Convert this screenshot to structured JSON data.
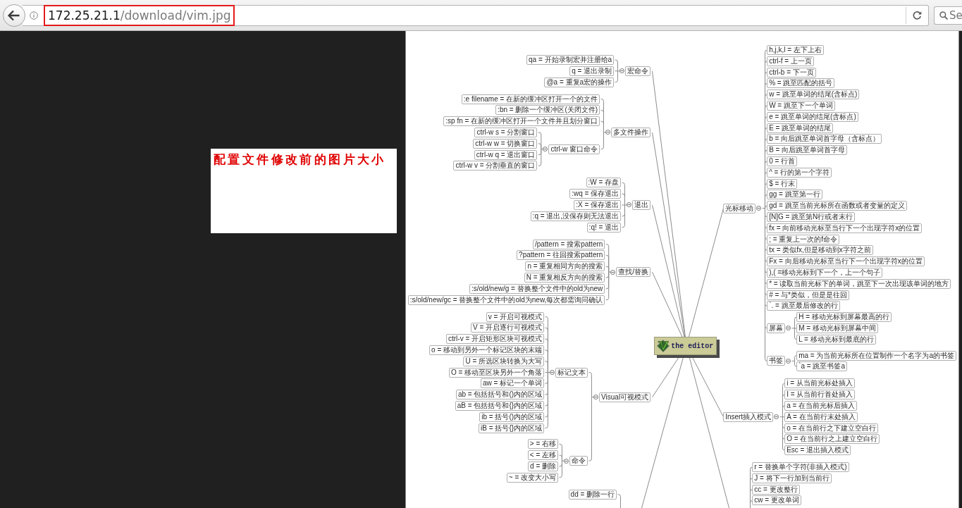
{
  "browser": {
    "url": {
      "host": "172.25.21.1",
      "path": "/download/vim.jpg"
    },
    "search": {
      "placeholder": "Se"
    }
  },
  "note": {
    "text": "配置文件修改前的图片大小"
  },
  "mindmap": {
    "center": "the editor",
    "left": [
      {
        "text": "宏命令",
        "children": [
          {
            "text": "qa = 开始录制宏并注册给a"
          },
          {
            "text": "q = 退出录制"
          },
          {
            "text": "@a = 重复a宏的操作"
          }
        ]
      },
      {
        "text": "多文件操作",
        "children": [
          {
            "text": ":e filename = 在新的缓冲区打开一个的文件"
          },
          {
            "text": ":bn = 删除一个缓冲区(关闭文件)"
          },
          {
            "text": ":sp fn = 在新的缓冲区打开一个文件并且划分窗口"
          },
          {
            "text": "ctrl-w 窗口命令",
            "children": [
              {
                "text": "ctrl-w s = 分割窗口"
              },
              {
                "text": "ctrl-w w = 切换窗口"
              },
              {
                "text": "ctrl-w q = 退出窗口"
              },
              {
                "text": "ctrl-w v = 分割垂直的窗口"
              }
            ]
          }
        ]
      },
      {
        "text": "退出",
        "children": [
          {
            "text": ":W = 存盘"
          },
          {
            "text": ":wq = 保存退出"
          },
          {
            "text": ":X = 保存退出"
          },
          {
            "text": ":q = 退出,没保存则无法退出"
          },
          {
            "text": ":q! = 退出"
          }
        ]
      },
      {
        "text": "查找/替换",
        "children": [
          {
            "text": "/pattern = 搜索pattern"
          },
          {
            "text": "?pattern = 往回搜索pattern"
          },
          {
            "text": "n = 重复相同方向的搜索"
          },
          {
            "text": "N = 重复相反方向的搜索"
          },
          {
            "text": ":s/old/new/g = 替换整个文件中的old为new"
          },
          {
            "text": ":s/old/new/gc = 替换整个文件中的old为new,每次都需询问确认"
          }
        ]
      },
      {
        "text": "Visual可视模式",
        "children": [
          {
            "text": "标记文本",
            "children": [
              {
                "text": "v = 开启可视模式"
              },
              {
                "text": "V = 开启逐行可视模式"
              },
              {
                "text": "ctrl-v = 开启矩形区块可视模式"
              },
              {
                "text": "o = 移动到另外一个标记区块的末端"
              },
              {
                "text": "U = 所选区块转换为大写"
              },
              {
                "text": "O = 移动至区块另外一个角落"
              },
              {
                "text": "aw = 标记一个单词"
              },
              {
                "text": "ab = 包括括号和()内的区域"
              },
              {
                "text": "aB = 包括括号和{}内的区域"
              },
              {
                "text": "ib = 括号()内的区域"
              },
              {
                "text": "iB = 括号{}内的区域"
              }
            ]
          },
          {
            "text": "命令",
            "children": [
              {
                "text": "> = 右移"
              },
              {
                "text": "< = 左移"
              },
              {
                "text": "d = 删除"
              },
              {
                "text": "~ = 改变大小写"
              }
            ]
          }
        ]
      },
      {
        "children": [
          {
            "text": "dd = 删除一行"
          }
        ]
      }
    ],
    "right": [
      {
        "text": "光标移动",
        "children": [
          {
            "text": "h,j,k,l = 左下上右"
          },
          {
            "text": "ctrl-f = 上一页"
          },
          {
            "text": "ctrl-b = 下一页"
          },
          {
            "text": "% = 跳至匹配的括号"
          },
          {
            "text": "w = 跳至单词的结尾(含标点)"
          },
          {
            "text": "W = 跳至下一个单词"
          },
          {
            "text": "e = 跳至单词的结尾(含标点)"
          },
          {
            "text": "E = 跳至单词的结尾"
          },
          {
            "text": "b = 向后跳至单词首字母（含标点）"
          },
          {
            "text": "B = 向后跳至单词首字母"
          },
          {
            "text": "0 = 行首"
          },
          {
            "text": "^ = 行的第一个字符"
          },
          {
            "text": "$ = 行末"
          },
          {
            "text": "gg = 跳至第一行"
          },
          {
            "text": "gd = 跳至当前光标所在函数或者变量的定义"
          },
          {
            "text": "[N]G = 跳至第N行或者末行"
          },
          {
            "text": "fx = 向前移动光标至当行下一个出现字符x的位置"
          },
          {
            "text": "; = 重复上一次的f命令"
          },
          {
            "text": "tx = 类似fx,但是移动到x字符之前"
          },
          {
            "text": "Fx = 向后移动光标至当行下一个出现字符x的位置"
          },
          {
            "text": "),( =移动光标到下一个，上一个句子"
          },
          {
            "text": "* = 读取当前光标下的单词，跳至下一次出现该单词的地方"
          },
          {
            "text": "# = 与*类似，但是是往回"
          },
          {
            "text": "`. = 跳至最后修改的行"
          },
          {
            "text": "屏幕",
            "children": [
              {
                "text": "H = 移动光标到屏幕最高的行"
              },
              {
                "text": "M = 移动光标到屏幕中间"
              },
              {
                "text": "L = 移动光标到最底的行"
              }
            ]
          },
          {
            "text": "书签",
            "children": [
              {
                "text": "ma = 为当前光标所在位置制作一个名字为a的书签"
              },
              {
                "text": "`a = 跳至书签a"
              }
            ]
          }
        ]
      },
      {
        "text": "Insert插入模式",
        "children": [
          {
            "text": "i = 从当前光标处插入"
          },
          {
            "text": "I = 从当前行首处插入"
          },
          {
            "text": "a = 在当前光标后插入"
          },
          {
            "text": "A = 在当前行末处插入"
          },
          {
            "text": "o = 在当前行之下建立空白行"
          },
          {
            "text": "O = 在当前行之上建立空白行"
          },
          {
            "text": "Esc = 退出插入模式"
          }
        ]
      },
      {
        "children": [
          {
            "text": "r = 替换单个字符(非插入模式)"
          },
          {
            "text": "J = 将下一行加到当前行"
          },
          {
            "text": "cc = 更改整行"
          },
          {
            "text": "cw = 更改单词"
          }
        ]
      }
    ]
  }
}
